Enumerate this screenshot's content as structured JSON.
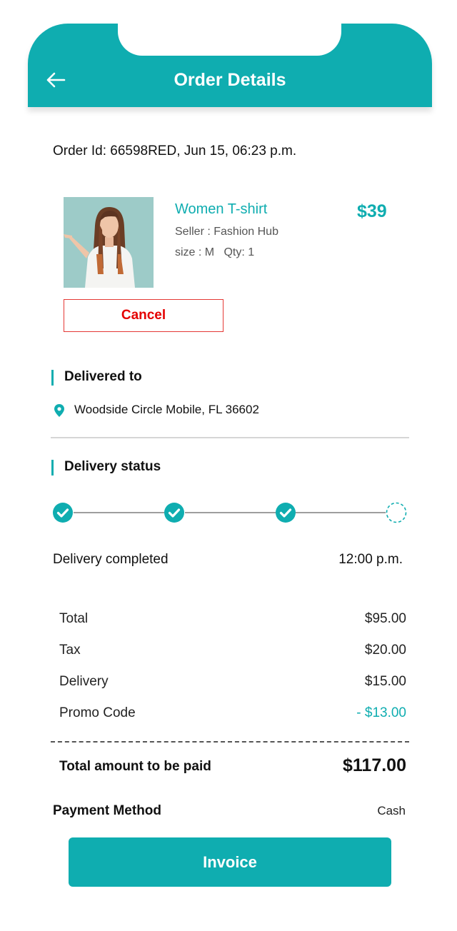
{
  "header": {
    "title": "Order Details"
  },
  "order": {
    "id_line": "Order Id: 66598RED, Jun 15, 06:23 p.m."
  },
  "product": {
    "name": "Women T-shirt",
    "seller": "Seller : Fashion Hub",
    "size_qty": "size : M   Qty: 1",
    "price": "$39",
    "cancel_label": "Cancel"
  },
  "delivery": {
    "section_title": "Delivered to",
    "address": "Woodside Circle Mobile, FL 36602"
  },
  "status": {
    "section_title": "Delivery status",
    "steps": [
      "complete",
      "complete",
      "complete",
      "pending"
    ],
    "text": "Delivery completed",
    "time": "12:00 p.m."
  },
  "summary": {
    "rows": [
      {
        "label": "Total",
        "value": "$95.00"
      },
      {
        "label": "Tax",
        "value": "$20.00"
      },
      {
        "label": "Delivery",
        "value": "$15.00"
      },
      {
        "label": "Promo Code",
        "value": "- $13.00"
      }
    ],
    "total_label": "Total amount to be paid",
    "total_value": "$117.00"
  },
  "payment": {
    "label": "Payment Method",
    "value": "Cash"
  },
  "invoice_label": "Invoice",
  "colors": {
    "accent": "#0fadb0",
    "cancel": "#e40000",
    "promo": "#0fadb0"
  },
  "icons": {
    "back": "arrow-left-icon",
    "location": "map-pin-icon",
    "step_done": "check-circle-icon",
    "step_pending": "dashed-circle-icon"
  }
}
